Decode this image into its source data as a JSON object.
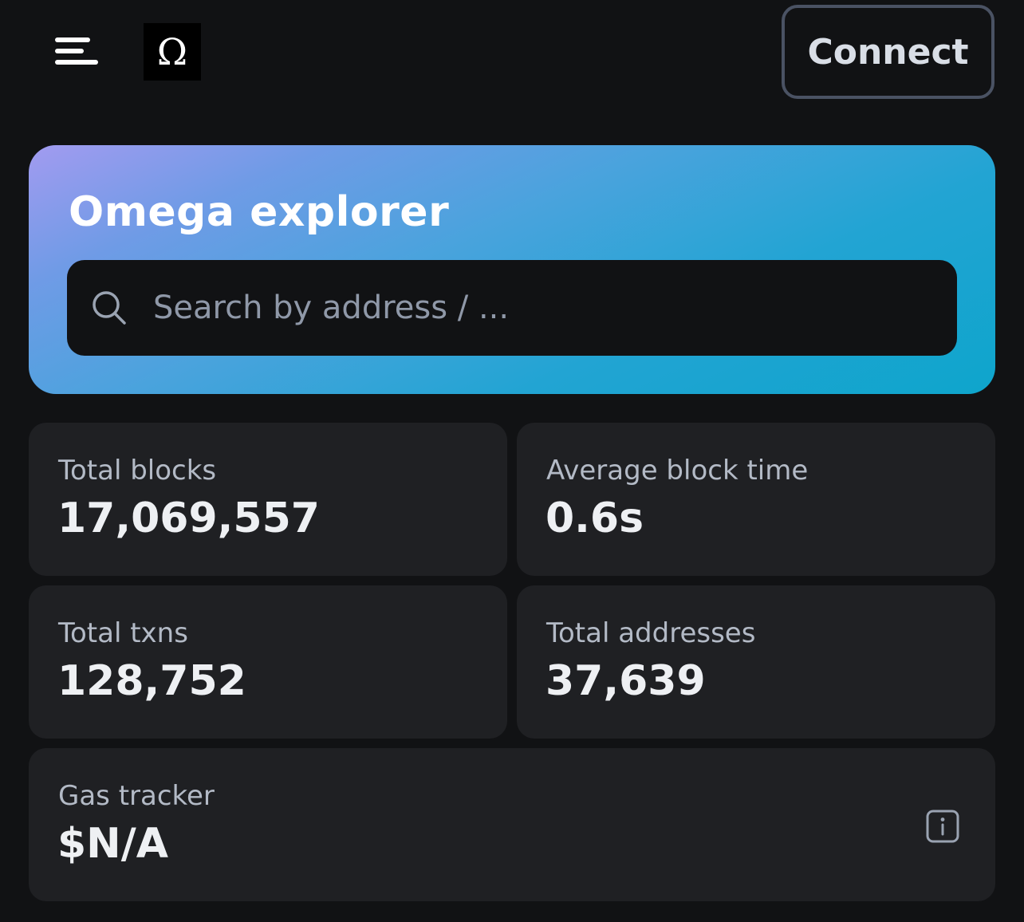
{
  "header": {
    "menu_icon": "menu-icon",
    "logo_glyph": "Ω",
    "connect_label": "Connect"
  },
  "hero": {
    "title": "Omega explorer",
    "gradient_start": "#a29bf0",
    "gradient_end": "#0ea5cc",
    "search": {
      "icon": "search-icon",
      "placeholder": "Search by address / ..."
    }
  },
  "stats": {
    "total_blocks": {
      "label": "Total blocks",
      "value": "17,069,557"
    },
    "avg_block_time": {
      "label": "Average block time",
      "value": "0.6s"
    },
    "total_txns": {
      "label": "Total txns",
      "value": "128,752"
    },
    "total_addresses": {
      "label": "Total addresses",
      "value": "37,639"
    },
    "gas_tracker": {
      "label": "Gas tracker",
      "value": "$N/A",
      "icon": "info-icon"
    }
  },
  "colors": {
    "background": "#111214",
    "card": "#1f2023",
    "label": "#b3bac6",
    "value": "#eef0f3",
    "button_border": "#4a5263"
  }
}
